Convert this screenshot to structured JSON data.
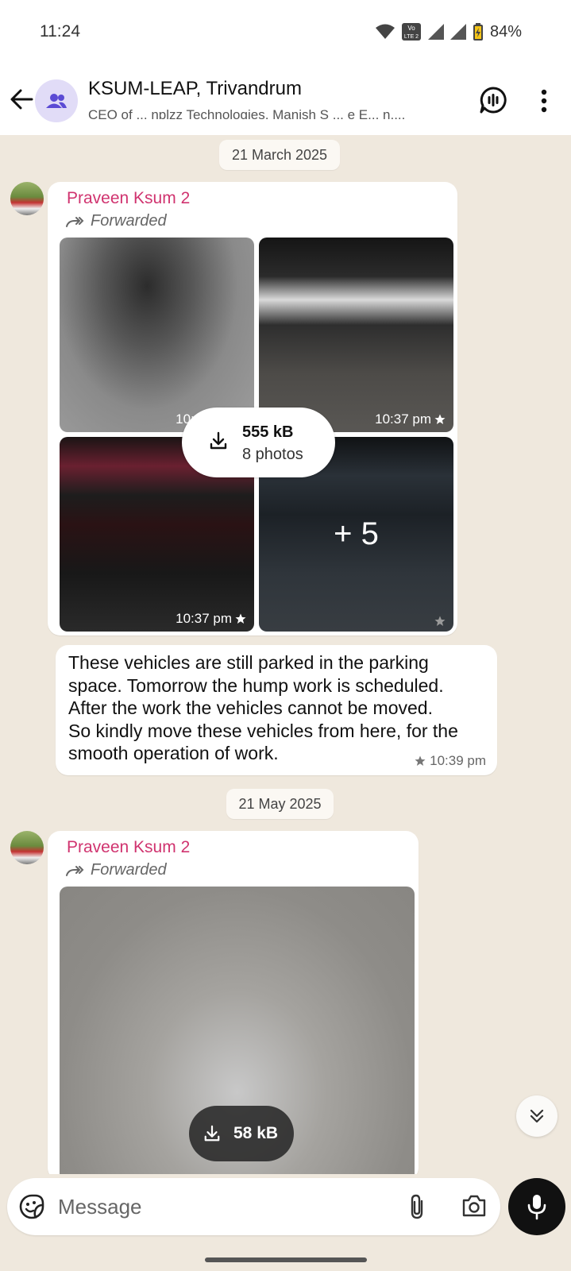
{
  "status_bar": {
    "time": "11:24",
    "battery": "84%",
    "network_label_top": "Vo",
    "network_label_bottom": "LTE 2"
  },
  "header": {
    "title": "KSUM-LEAP, Trivandrum",
    "subtitle": "CEO of ... nplzz Technologies, Manish S ... e E... n,..."
  },
  "messages": [
    {
      "date": "21 March 2025",
      "sender": "Praveen Ksum 2",
      "forwarded_label": "Forwarded",
      "photo_times": [
        "10:37 pm",
        "10:37 pm",
        "10:37 pm"
      ],
      "more_count": "+ 5",
      "download_size": "555 kB",
      "download_count": "8 photos",
      "text_lines": [
        "These vehicles are still parked in the parking",
        "space. Tomorrow the hump work is scheduled.",
        "After the work the vehicles cannot be moved.",
        "So kindly move these vehicles from here, for the",
        "smooth operation of work."
      ],
      "text_time": "10:39 pm"
    },
    {
      "date": "21 May 2025",
      "sender": "Praveen Ksum 2",
      "forwarded_label": "Forwarded",
      "download_size": "58 kB"
    }
  ],
  "composer": {
    "placeholder": "Message"
  },
  "colors": {
    "sender_name": "#d0336f",
    "chat_background": "#efe8dd",
    "group_avatar_bg": "#e1dcf7"
  },
  "icons": [
    "back-arrow-icon",
    "group-icon",
    "voice-chat-icon",
    "more-vert-icon",
    "forward-icon",
    "download-icon",
    "star-icon",
    "chevron-double-down-icon",
    "emoji-icon",
    "attach-icon",
    "camera-icon",
    "mic-icon",
    "wifi-icon",
    "signal-icon",
    "battery-icon"
  ]
}
